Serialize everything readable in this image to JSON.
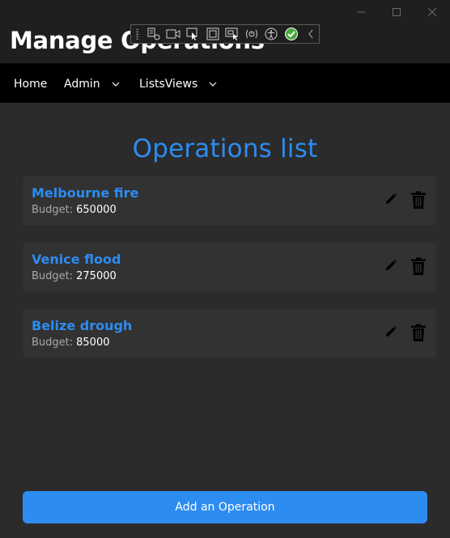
{
  "window": {
    "title": "Manage Operations",
    "controls": {
      "minimize": "—",
      "maximize": "☐",
      "close": "✕"
    }
  },
  "debug_toolbar": {
    "icons": [
      "live-visual-tree-icon",
      "record-icon",
      "select-element-icon",
      "display-layout-adorners-icon",
      "track-focus-icon",
      "binding-failures-icon",
      "accessibility-icon",
      "check-icon",
      "collapse-chevron-icon"
    ]
  },
  "nav": {
    "home": "Home",
    "admin": "Admin",
    "lists_views": "ListsViews"
  },
  "main": {
    "title": "Operations list",
    "budget_label": "Budget:",
    "operations": [
      {
        "name": "Melbourne fire",
        "budget": "650000"
      },
      {
        "name": "Venice flood",
        "budget": "275000"
      },
      {
        "name": "Belize drough",
        "budget": "85000"
      }
    ],
    "add_button": "Add an Operation"
  },
  "colors": {
    "accent": "#2d8cf0",
    "background": "#2b2b2b",
    "card": "#323232",
    "navbar": "#000000"
  }
}
